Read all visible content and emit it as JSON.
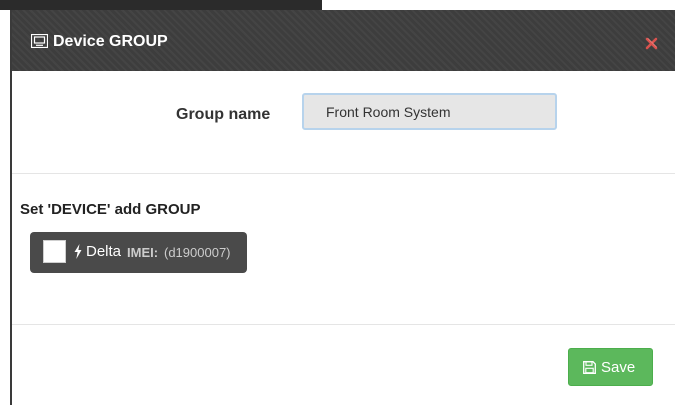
{
  "modal": {
    "title": "Device GROUP",
    "title_icon": "device-icon",
    "close_icon": "close-icon"
  },
  "form": {
    "group_name_label": "Group name",
    "group_name_value": "Front Room System"
  },
  "devices_section": {
    "title": "Set 'DEVICE' add GROUP",
    "devices": [
      {
        "icon": "bolt-icon",
        "name": "Delta",
        "imei_label": "IMEI:",
        "imei": "(d1900007)",
        "checked": false
      }
    ]
  },
  "footer": {
    "save_label": "Save",
    "save_icon": "floppy-disk-icon"
  },
  "colors": {
    "header_bg": "#3d3d3d",
    "close_red": "#d9534f",
    "save_green": "#5cb85c",
    "chip_bg": "#4a4a4a",
    "input_border": "#b7d3ec"
  }
}
